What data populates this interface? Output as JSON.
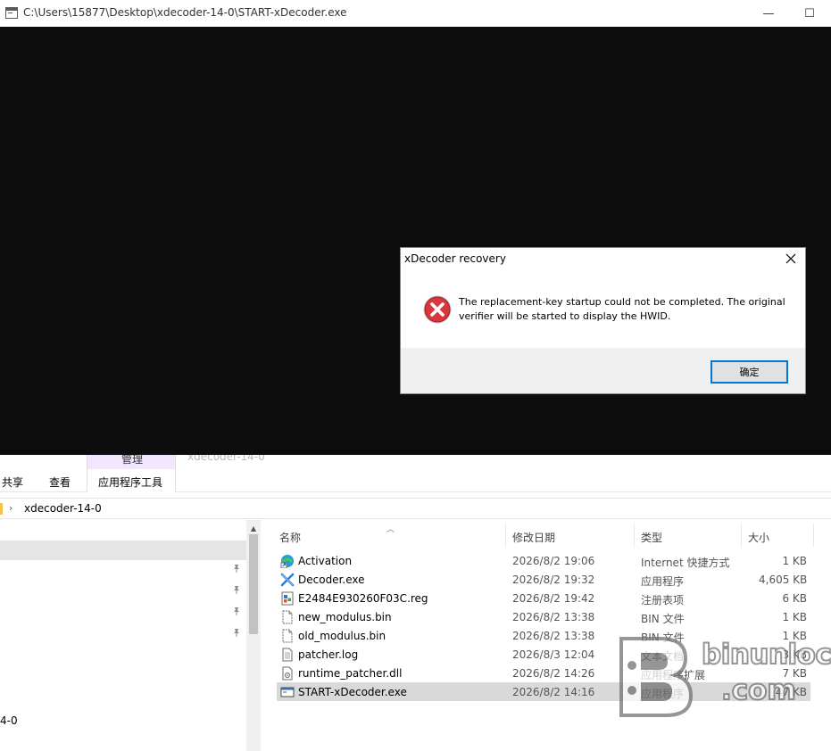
{
  "console": {
    "title": "C:\\Users\\15877\\Desktop\\xdecoder-14-0\\START-xDecoder.exe",
    "minimize_glyph": "—",
    "maximize_glyph": "☐"
  },
  "dialog": {
    "title": "xDecoder recovery",
    "close_glyph": "✕",
    "icon": "error-icon",
    "message": "The replacement-key startup could not be completed. The original verifier will be started to display the HWID.",
    "ok_label": "确定"
  },
  "explorer": {
    "ribbon": {
      "context_group_label": "管理",
      "ghost_title": "xdecoder-14-0",
      "tabs": [
        {
          "label": "共享"
        },
        {
          "label": "查看"
        },
        {
          "label": "应用程序工具"
        }
      ]
    },
    "address": {
      "chevron": "›",
      "path": "xdecoder-14-0"
    },
    "nav": {
      "partial_item": "4-0",
      "pin_glyph": "📌"
    },
    "columns": {
      "name": "名称",
      "date": "修改日期",
      "type": "类型",
      "size": "大小"
    },
    "files": [
      {
        "name": "Activation",
        "date": "2026/8/2 19:06",
        "type": "Internet 快捷方式",
        "size": "1 KB",
        "icon": "internet-shortcut-icon"
      },
      {
        "name": "Decoder.exe",
        "date": "2026/8/2 19:32",
        "type": "应用程序",
        "size": "4,605 KB",
        "icon": "decoder-app-icon"
      },
      {
        "name": "E2484E930260F03C.reg",
        "date": "2026/8/2 19:42",
        "type": "注册表项",
        "size": "6 KB",
        "icon": "registry-file-icon"
      },
      {
        "name": "new_modulus.bin",
        "date": "2026/8/2 13:38",
        "type": "BIN 文件",
        "size": "1 KB",
        "icon": "bin-file-icon"
      },
      {
        "name": "old_modulus.bin",
        "date": "2026/8/2 13:38",
        "type": "BIN 文件",
        "size": "1 KB",
        "icon": "bin-file-icon"
      },
      {
        "name": "patcher.log",
        "date": "2026/8/3 12:04",
        "type": "文本文档",
        "size": "3 KB",
        "icon": "text-file-icon"
      },
      {
        "name": "runtime_patcher.dll",
        "date": "2026/8/2 14:26",
        "type": "应用程序扩展",
        "size": "7 KB",
        "icon": "dll-file-icon"
      },
      {
        "name": "START-xDecoder.exe",
        "date": "2026/8/2 14:16",
        "type": "应用程序",
        "size": "47 KB",
        "icon": "exe-app-icon"
      }
    ]
  },
  "watermark": {
    "line1": "binunlock",
    "line2": ".com"
  },
  "colors": {
    "console_bg": "#0c0c0c",
    "dialog_bg": "#f0f0f0",
    "accent": "#0078d7",
    "error_red": "#d9363e",
    "context_tab": "#f2e6ff",
    "selected_row": "#d9d9d9"
  }
}
